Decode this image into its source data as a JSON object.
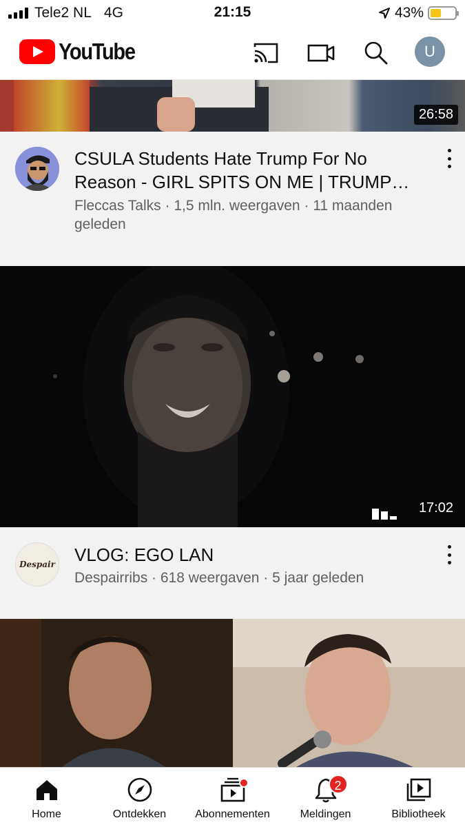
{
  "status_bar": {
    "carrier": "Tele2 NL",
    "network": "4G",
    "time": "21:15",
    "battery": "43%",
    "battery_level": 0.43
  },
  "header": {
    "logo_text": "YouTube",
    "icons": [
      "cast-icon",
      "camera-icon",
      "search-icon",
      "avatar"
    ],
    "avatar_letter": "U",
    "brand_color": "#FF0000"
  },
  "videos": [
    {
      "duration": "26:58",
      "title": "CSULA Students Hate Trump For No Reason - GIRL SPITS ON ME | TRUMP…",
      "subtitle": "Fleccas Talks · 1,5 mln. weergaven · 11 maanden geleden"
    },
    {
      "duration": "17:02",
      "title": "VLOG: EGO LAN",
      "subtitle": "Despairribs · 618 weergaven · 5 jaar geleden",
      "avatar_text": "Despair"
    }
  ],
  "bottom_nav": {
    "items": [
      {
        "label": "Home",
        "icon": "home-icon"
      },
      {
        "label": "Ontdekken",
        "icon": "compass-icon"
      },
      {
        "label": "Abonnementen",
        "icon": "subscriptions-icon"
      },
      {
        "label": "Meldingen",
        "icon": "bell-icon"
      },
      {
        "label": "Bibliotheek",
        "icon": "library-icon"
      }
    ],
    "notification_count": "2"
  }
}
